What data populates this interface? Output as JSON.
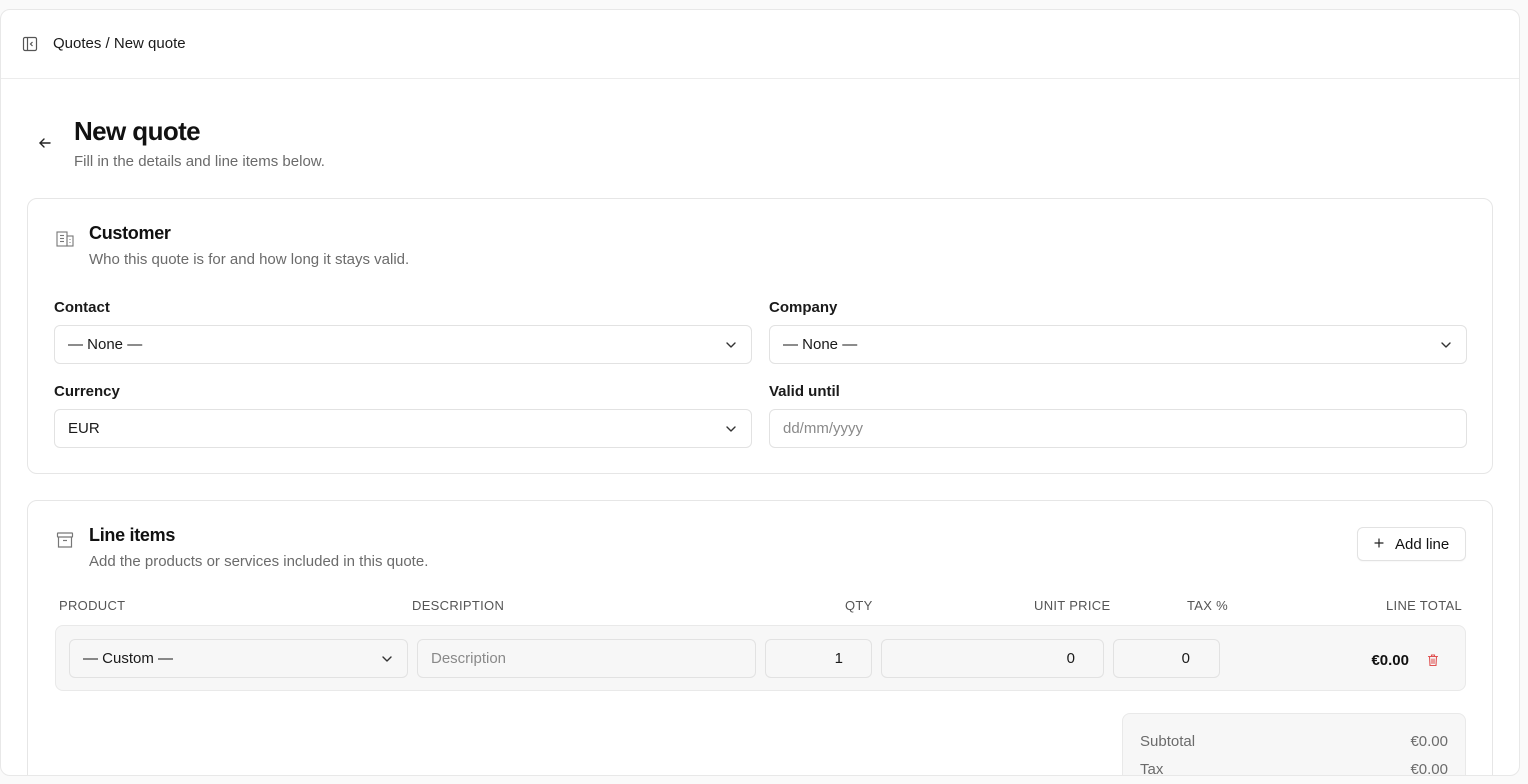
{
  "breadcrumb": "Quotes / New quote",
  "page": {
    "title": "New quote",
    "subtitle": "Fill in the details and line items below."
  },
  "customer": {
    "title": "Customer",
    "description": "Who this quote is for and how long it stays valid.",
    "contact": {
      "label": "Contact",
      "value": "— None —"
    },
    "company": {
      "label": "Company",
      "value": "— None —"
    },
    "currency": {
      "label": "Currency",
      "value": "EUR"
    },
    "valid_until": {
      "label": "Valid until",
      "placeholder": "dd/mm/yyyy"
    }
  },
  "line_items": {
    "title": "Line items",
    "description": "Add the products or services included in this quote.",
    "add_button": "Add line",
    "columns": {
      "product": "PRODUCT",
      "description": "DESCRIPTION",
      "qty": "QTY",
      "unit_price": "UNIT PRICE",
      "tax": "TAX %",
      "line_total": "LINE TOTAL"
    },
    "rows": [
      {
        "product": "— Custom —",
        "description_placeholder": "Description",
        "qty": "1",
        "unit_price": "0",
        "tax": "0",
        "line_total": "€0.00"
      }
    ]
  },
  "totals": {
    "subtotal_label": "Subtotal",
    "subtotal_value": "€0.00",
    "tax_label": "Tax",
    "tax_value": "€0.00"
  },
  "icons": {
    "sidebar_toggle": "sidebar-toggle-icon",
    "back": "arrow-left-icon",
    "customer": "building-icon",
    "line_items": "archive-box-icon",
    "select": "chevron-down-icon",
    "add": "plus-icon",
    "delete": "trash-icon"
  },
  "colors": {
    "danger": "#e05252",
    "muted_text": "#6b6b6b"
  }
}
